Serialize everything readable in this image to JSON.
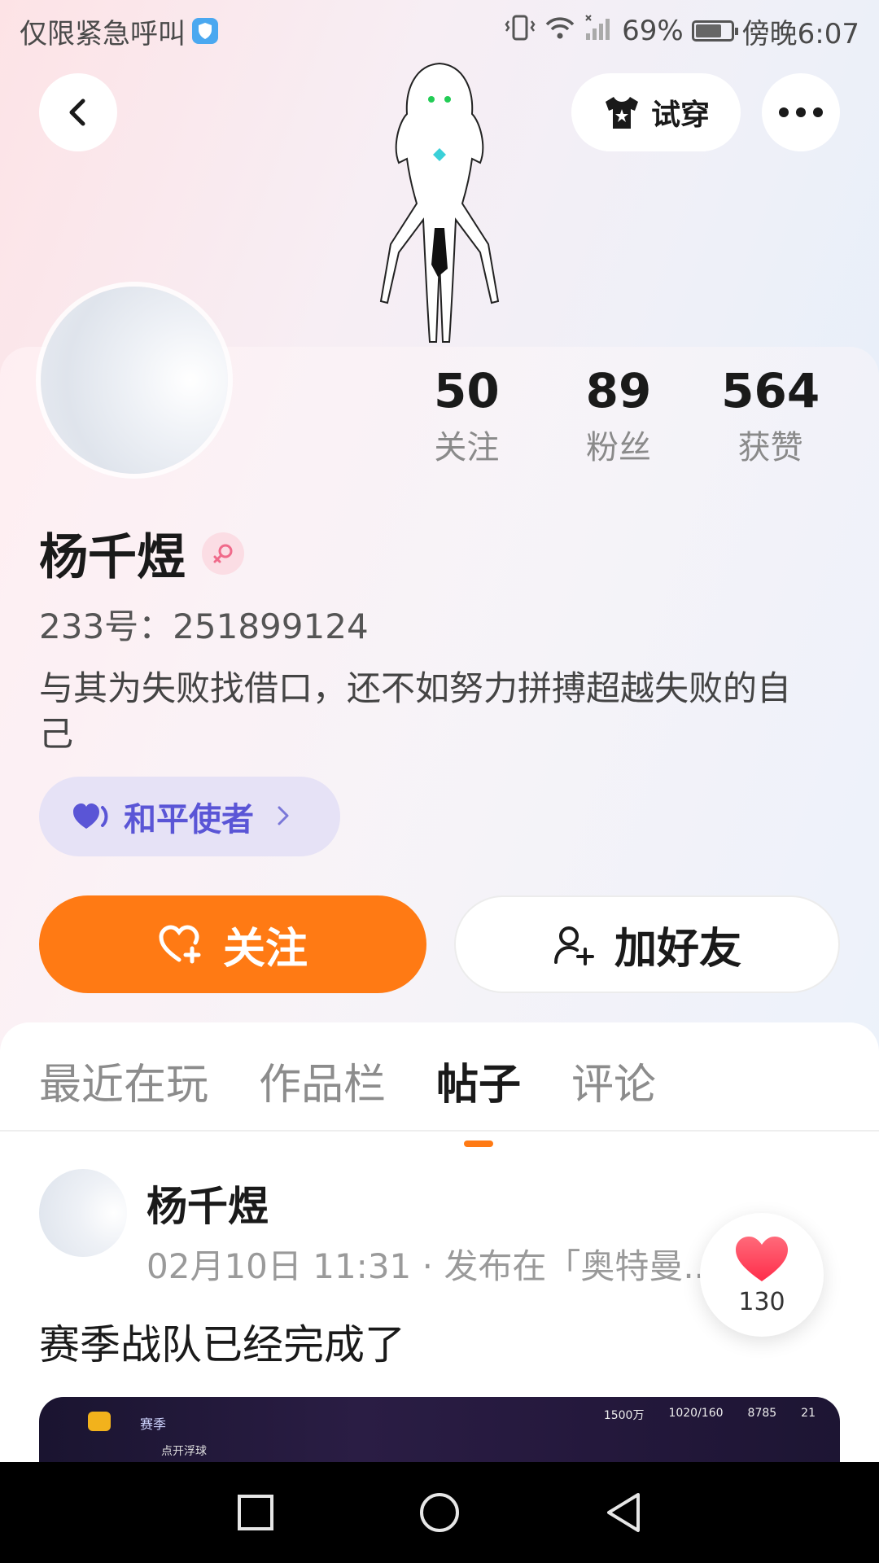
{
  "status_bar": {
    "left_text": "仅限紧急呼叫",
    "battery": "69%",
    "time": "傍晚6:07"
  },
  "header": {
    "tryon_label": "试穿"
  },
  "profile": {
    "stats": [
      {
        "value": "50",
        "label": "关注"
      },
      {
        "value": "89",
        "label": "粉丝"
      },
      {
        "value": "564",
        "label": "获赞"
      }
    ],
    "name": "杨千煜",
    "uid": "233号：251899124",
    "bio": "与其为失败找借口，还不如努力拼搏超越失败的自己",
    "tag": "和平使者",
    "follow_label": "关注",
    "add_friend_label": "加好友"
  },
  "tabs": [
    {
      "label": "最近在玩",
      "active": false
    },
    {
      "label": "作品栏",
      "active": false
    },
    {
      "label": "帖子",
      "active": true
    },
    {
      "label": "评论",
      "active": false
    }
  ],
  "post": {
    "author": "杨千煜",
    "meta": "02月10日 11:31 · 发布在「奥特曼...",
    "text": "赛季战队已经完成了",
    "like_count": "130",
    "image": {
      "season_label": "赛季",
      "stat_coins": "1500万",
      "stat_energy": "1020/160",
      "stat_gems": "8785",
      "stat_level": "21",
      "float_label": "点开浮球"
    }
  },
  "colors": {
    "accent": "#ff7a14",
    "tag_text": "#5a55d6",
    "tag_bg": "#e6e2f6",
    "like": "#ff3d55"
  }
}
